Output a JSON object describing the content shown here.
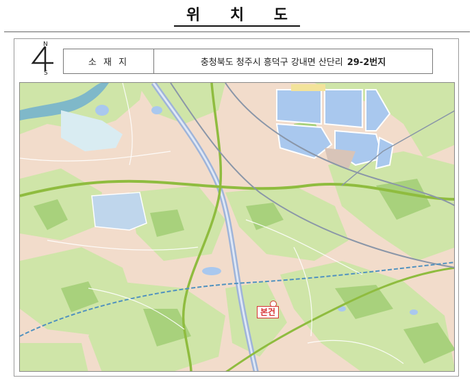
{
  "title": "위 치 도",
  "compass": {
    "north": "N",
    "south": "S",
    "icon": "north-arrow-icon"
  },
  "info": {
    "label": "소 재 지",
    "address": "충청북도 청주시 흥덕구 강내면 산단리",
    "lot": "29-2번지"
  },
  "map": {
    "site_label": "본건",
    "colors": {
      "base": "#f2dccb",
      "green": "#cfe5a8",
      "dark_green": "#a8d17c",
      "water": "#7fb8c9",
      "urban_blue": "#a9c8ee",
      "highway": "#9fb4d9",
      "rail": "#4f91bf",
      "site": "#d63030"
    }
  }
}
